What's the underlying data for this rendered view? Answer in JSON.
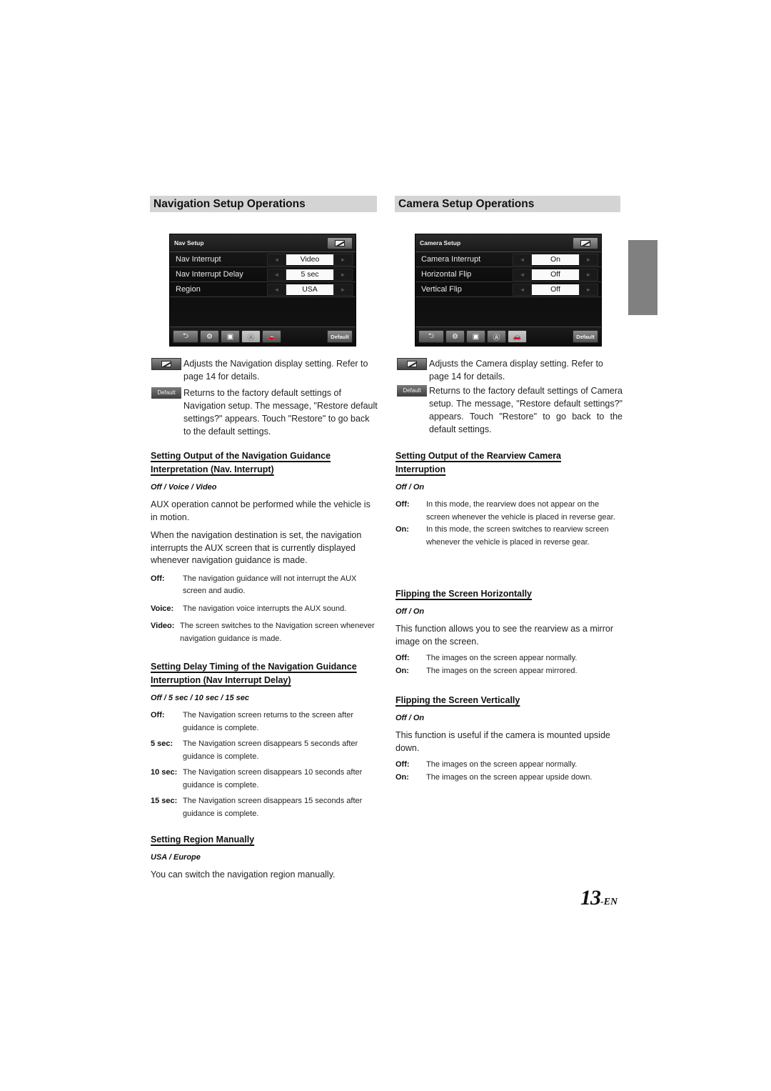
{
  "navigation": {
    "section_title": "Navigation Setup Operations",
    "screen": {
      "title": "Nav Setup",
      "rows": [
        {
          "label": "Nav Interrupt",
          "value": "Video"
        },
        {
          "label": "Nav Interrupt Delay",
          "value": "5 sec"
        },
        {
          "label": "Region",
          "value": "USA"
        }
      ],
      "toolbar": {
        "default_label": "Default",
        "active_tab": "navigation"
      }
    },
    "legend": {
      "display_desc": "Adjusts the Navigation display setting. Refer to page 14 for details.",
      "default_badge": "Default",
      "default_desc": "Returns to the factory default settings of Navigation setup. The message, \"Restore default settings?\" appears. Touch \"Restore\" to go back to the default settings."
    },
    "sections": [
      {
        "heading_line1": "Setting Output of the Navigation Guidance",
        "heading_line2": "Interpretation (Nav. Interrupt)",
        "options": "Off / Voice / Video",
        "paras": [
          "AUX operation cannot be performed while the vehicle is in motion.",
          "When the navigation destination is set, the navigation interrupts the AUX screen that is currently displayed whenever navigation guidance is made."
        ],
        "defs": [
          {
            "term": "Off:",
            "desc": "The navigation guidance will not interrupt the AUX screen and audio."
          },
          {
            "term": "Voice:",
            "desc": "The navigation voice interrupts the AUX sound."
          },
          {
            "term": "Video:",
            "desc": "The screen switches to the Navigation screen whenever navigation guidance is made."
          }
        ]
      },
      {
        "heading_line1": "Setting Delay Timing of the Navigation Guidance",
        "heading_line2": "Interruption (Nav Interrupt Delay)",
        "options": "Off / 5 sec / 10 sec / 15 sec",
        "defs": [
          {
            "term": "Off:",
            "desc": "The Navigation screen returns to the screen after guidance is complete."
          },
          {
            "term": "5 sec:",
            "desc": "The Navigation screen disappears 5 seconds after guidance is complete."
          },
          {
            "term": "10 sec:",
            "desc": "The Navigation screen disappears 10 seconds after guidance is complete."
          },
          {
            "term": "15 sec:",
            "desc": "The Navigation screen disappears 15 seconds after guidance is complete."
          }
        ]
      },
      {
        "heading_line1": "Setting Region Manually",
        "options": "USA / Europe",
        "paras": [
          "You can switch the navigation region manually."
        ]
      }
    ]
  },
  "camera": {
    "section_title": "Camera Setup Operations",
    "screen": {
      "title": "Camera Setup",
      "rows": [
        {
          "label": "Camera Interrupt",
          "value": "On"
        },
        {
          "label": "Horizontal Flip",
          "value": "Off"
        },
        {
          "label": "Vertical Flip",
          "value": "Off"
        }
      ],
      "toolbar": {
        "default_label": "Default",
        "active_tab": "camera"
      }
    },
    "legend": {
      "display_desc": "Adjusts the Camera display setting. Refer to page 14 for details.",
      "default_badge": "Default",
      "default_desc": "Returns to the factory default settings of Camera setup. The message, \"Restore default settings?\" appears. Touch \"Restore\" to go back to the default settings."
    },
    "sections": [
      {
        "heading_line1": "Setting Output of the Rearview Camera",
        "heading_line2": "Interruption",
        "options": "Off / On",
        "defs": [
          {
            "term": "Off:",
            "desc": "In this mode, the rearview does not appear on the screen whenever the vehicle is placed in reverse gear."
          },
          {
            "term": "On:",
            "desc": "In this mode, the screen switches to rearview screen whenever the vehicle is placed in reverse gear."
          }
        ]
      },
      {
        "heading_line1": "Flipping the Screen Horizontally",
        "options": "Off / On",
        "paras": [
          "This function allows you to see the rearview as a mirror image on the screen."
        ],
        "defs": [
          {
            "term": "Off:",
            "desc": "The images on the screen appear normally."
          },
          {
            "term": "On:",
            "desc": "The images on the screen appear mirrored."
          }
        ]
      },
      {
        "heading_line1": "Flipping the Screen Vertically",
        "options": "Off / On",
        "paras": [
          "This function is useful if the camera is mounted upside down."
        ],
        "defs": [
          {
            "term": "Off:",
            "desc": "The images on the screen appear normally."
          },
          {
            "term": "On:",
            "desc": "The images on the screen appear upside down."
          }
        ]
      }
    ]
  },
  "icons": {
    "left_arrow": "◄",
    "right_arrow": "►",
    "back": "⮌",
    "settings": "⚙",
    "media": "▣",
    "navigation": "Ⓐ",
    "camera": "🚗"
  },
  "page": {
    "number": "13",
    "suffix": "-EN"
  }
}
